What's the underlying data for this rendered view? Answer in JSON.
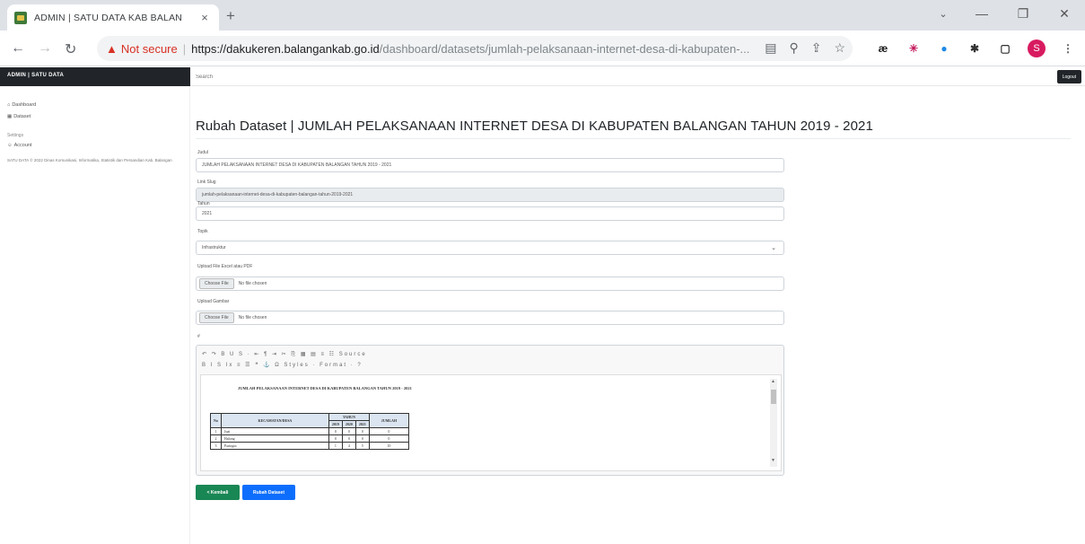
{
  "browser": {
    "tab_title": "ADMIN | SATU DATA KAB BALAN",
    "tab_close": "×",
    "new_tab": "+",
    "not_secure": "Not secure",
    "url_host": "https://dakukeren.balangankab.go.id",
    "url_path": "/dashboard/datasets/jumlah-pelaksanaan-internet-desa-di-kabupaten-...",
    "profile_initial": "S"
  },
  "app": {
    "brand": "ADMIN | SATU DATA",
    "search_placeholder": "Search",
    "logout": "Logout"
  },
  "sidebar": {
    "items": [
      {
        "label": "Dashboard",
        "icon": "home-icon"
      },
      {
        "label": "Dataset",
        "icon": "database-icon"
      }
    ],
    "heading": "Settings",
    "account_item": {
      "label": "Account",
      "icon": "user-icon"
    },
    "footer": "SATU DATA © 2022 Dinas Komunikasi, Informatika, Statistik dan Persandian Kab. Balangan"
  },
  "form": {
    "page_title": "Rubah Dataset | JUMLAH PELAKSANAAN INTERNET DESA DI KABUPATEN BALANGAN TAHUN 2019 - 2021",
    "judul_label": "Judul",
    "judul_value": "JUMLAH PELAKSANAAN INTERNET DESA DI KABUPATEN BALANGAN TAHUN 2019 - 2021",
    "slug_label": "Link Slug",
    "slug_value": "jumlah-pelaksanaan-internet-desa-di-kabupaten-balangan-tahun-2019-2021",
    "tahun_label": "Tahun",
    "tahun_value": "2021",
    "topik_label": "Topik",
    "topik_value": "Infrastruktur",
    "file_label": "Upload File Excel atau PDF",
    "file_button": "Choose File",
    "file_status": "No file chosen",
    "gambar_label": "Upload Gambar",
    "gambar_button": "Choose File",
    "gambar_status": "No file chosen",
    "editor_label": "#",
    "toolbar_row1": "↶ ↷  B  U  S  ·  ⇤ ¶  ⇥  ✂ ⎘ ▦ ▤ ≡ ☷  Source",
    "toolbar_row2": "B  I  S  I<sub>x</sub>  ≡  ☰  ❝  ⚓  Ω  Styles  Format  ?",
    "toolbar_row2_plain": "B  I  S  Ix  ≡  ☰  ❝  ⚓  Ω  Styles  ·  Format  ·  ?",
    "doc_title": "JUMLAH PELAKSANAAN INTERNET DESA DI KABUPATEN BALANGAN TAHUN 2019 - 2021",
    "doc_headers": {
      "no": "No",
      "kecamatan": "KECAMATAN/DESA",
      "tahun": "TAHUN",
      "jumlah": "JUMLAH",
      "y1": "2019",
      "y2": "2020",
      "y3": "2021"
    },
    "doc_rows": [
      {
        "no": "1",
        "name": "Juai",
        "y1": "0",
        "y2": "0",
        "y3": "0",
        "total": "0"
      },
      {
        "no": "2",
        "name": "Halong",
        "y1": "0",
        "y2": "0",
        "y3": "0",
        "total": "0"
      },
      {
        "no": "3",
        "name": "Paringin",
        "y1": "1",
        "y2": "4",
        "y3": "5",
        "total": "10"
      }
    ],
    "back_button": "< Kembali",
    "submit_button": "Rubah Dataset"
  }
}
